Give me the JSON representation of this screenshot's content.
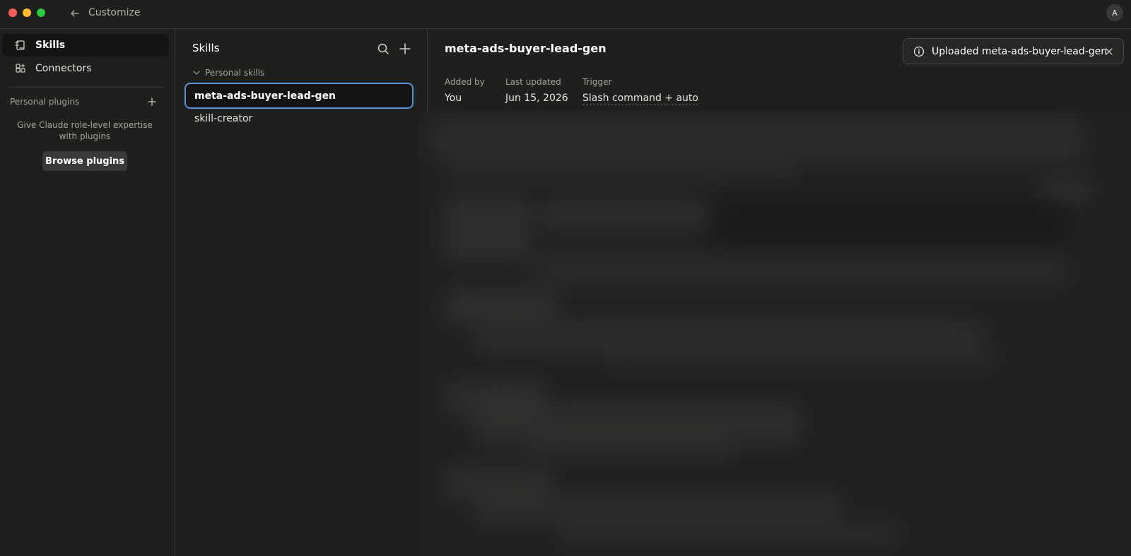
{
  "window": {
    "title": "Customize",
    "avatar_initial": "A"
  },
  "sidebar": {
    "items": [
      {
        "label": "Skills",
        "icon": "skills-icon",
        "active": true
      },
      {
        "label": "Connectors",
        "icon": "connectors-icon",
        "active": false
      }
    ],
    "personal_plugins": {
      "label": "Personal plugins",
      "hint": "Give Claude role-level expertise with plugins",
      "browse_label": "Browse plugins"
    }
  },
  "skills_panel": {
    "header": "Skills",
    "group_label": "Personal skills",
    "items": [
      {
        "label": "meta-ads-buyer-lead-gen",
        "selected": true
      },
      {
        "label": "skill-creator",
        "selected": false
      }
    ]
  },
  "detail": {
    "title": "meta-ads-buyer-lead-gen",
    "meta": [
      {
        "label": "Added by",
        "value": "You"
      },
      {
        "label": "Last updated",
        "value": "Jun 15, 2026"
      },
      {
        "label": "Trigger",
        "value": "Slash command + auto"
      }
    ]
  },
  "toast": {
    "message": "Uploaded meta-ads-buyer-lead-gen",
    "icon": "info-icon"
  },
  "colors": {
    "background": "#1f1f1e",
    "selected_border": "#5b8fd8",
    "close": "#ff5f57",
    "minimize": "#febc2e",
    "maximize": "#28c840"
  }
}
